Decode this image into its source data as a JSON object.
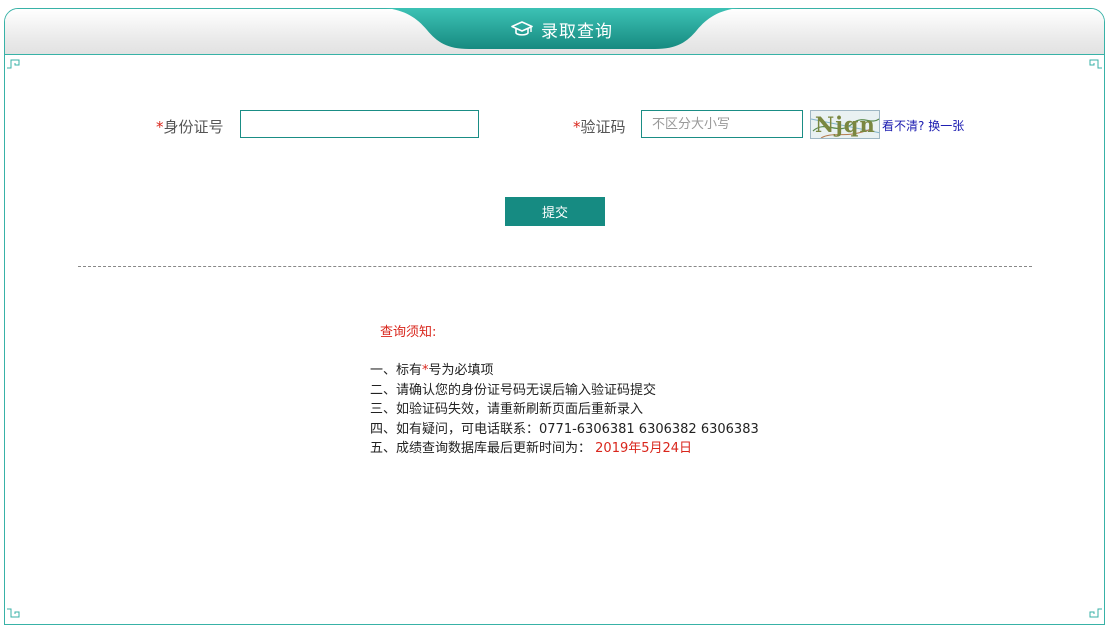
{
  "header": {
    "title": "录取查询",
    "icon": "graduation-cap-icon",
    "accent_color": "#1e9d91"
  },
  "form": {
    "id_label": "身份证号",
    "id_value": "",
    "captcha_label": "验证码",
    "captcha_placeholder": "不区分大小写",
    "required_mark": "*",
    "captcha_image_text": "Njqn",
    "refresh_prefix": "看不清?",
    "refresh_link": "换一张",
    "submit_label": "提交"
  },
  "notice": {
    "title": "查询须知:",
    "item1_before": "一、标有",
    "item1_star": "*",
    "item1_after": "号为必填项",
    "item2": "二、请确认您的身份证号码无误后输入验证码提交",
    "item3": "三、如验证码失效，请重新刷新页面后重新录入",
    "item4": "四、如有疑问，可电话联系：0771-6306381 6306382 6306383",
    "item5_prefix": "五、成绩查询数据库最后更新时间为：",
    "item5_date": "2019年5月24日"
  },
  "colors": {
    "required": "#d9261c",
    "button": "#168b82",
    "border": "#38b2a7"
  }
}
